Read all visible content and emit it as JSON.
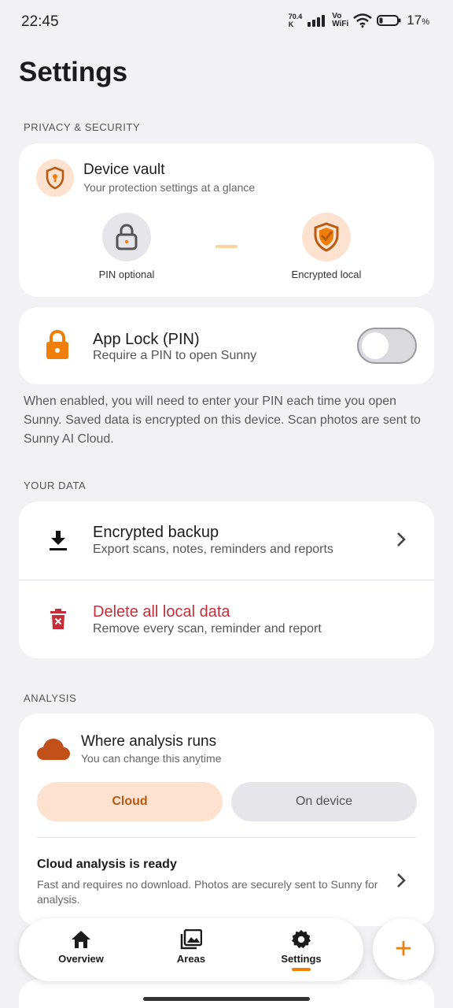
{
  "status_bar": {
    "time": "22:45",
    "net_speed_value": "70.4",
    "net_speed_unit": "K",
    "volte_top": "Vo",
    "volte_bottom": "WiFi",
    "battery_percent": "17",
    "battery_percent_sign": "%"
  },
  "page": {
    "title": "Settings"
  },
  "privacy": {
    "section_label": "PRIVACY & SECURITY",
    "vault": {
      "title": "Device vault",
      "subtitle": "Your protection settings at a glance",
      "pin_caption": "PIN optional",
      "encrypted_caption": "Encrypted local"
    },
    "app_lock": {
      "title": "App Lock (PIN)",
      "subtitle": "Require a PIN to open Sunny",
      "enabled": false
    },
    "info_text": "When enabled, you will need to enter your PIN each time you open Sunny. Saved data is encrypted on this device. Scan photos are sent to Sunny AI Cloud."
  },
  "your_data": {
    "section_label": "YOUR DATA",
    "backup": {
      "title": "Encrypted backup",
      "subtitle": "Export scans, notes, reminders and reports"
    },
    "delete": {
      "title": "Delete all local data",
      "subtitle": "Remove every scan, reminder and report"
    }
  },
  "analysis": {
    "section_label": "ANALYSIS",
    "title": "Where analysis runs",
    "subtitle": "You can change this anytime",
    "options": [
      "Cloud",
      "On device"
    ],
    "selected": "Cloud",
    "ready_title": "Cloud analysis is ready",
    "ready_text": "Fast and requires no download. Photos are securely sent to Sunny for analysis."
  },
  "nav": {
    "items": [
      {
        "label": "Overview",
        "icon": "home-icon"
      },
      {
        "label": "Areas",
        "icon": "gallery-icon"
      },
      {
        "label": "Settings",
        "icon": "gear-icon"
      }
    ],
    "active": "Settings",
    "fab_label": "+"
  },
  "colors": {
    "accent": "#f07f0a",
    "danger": "#c62d3a",
    "accent_soft": "#fde3cf",
    "background": "#f2f2f5"
  }
}
